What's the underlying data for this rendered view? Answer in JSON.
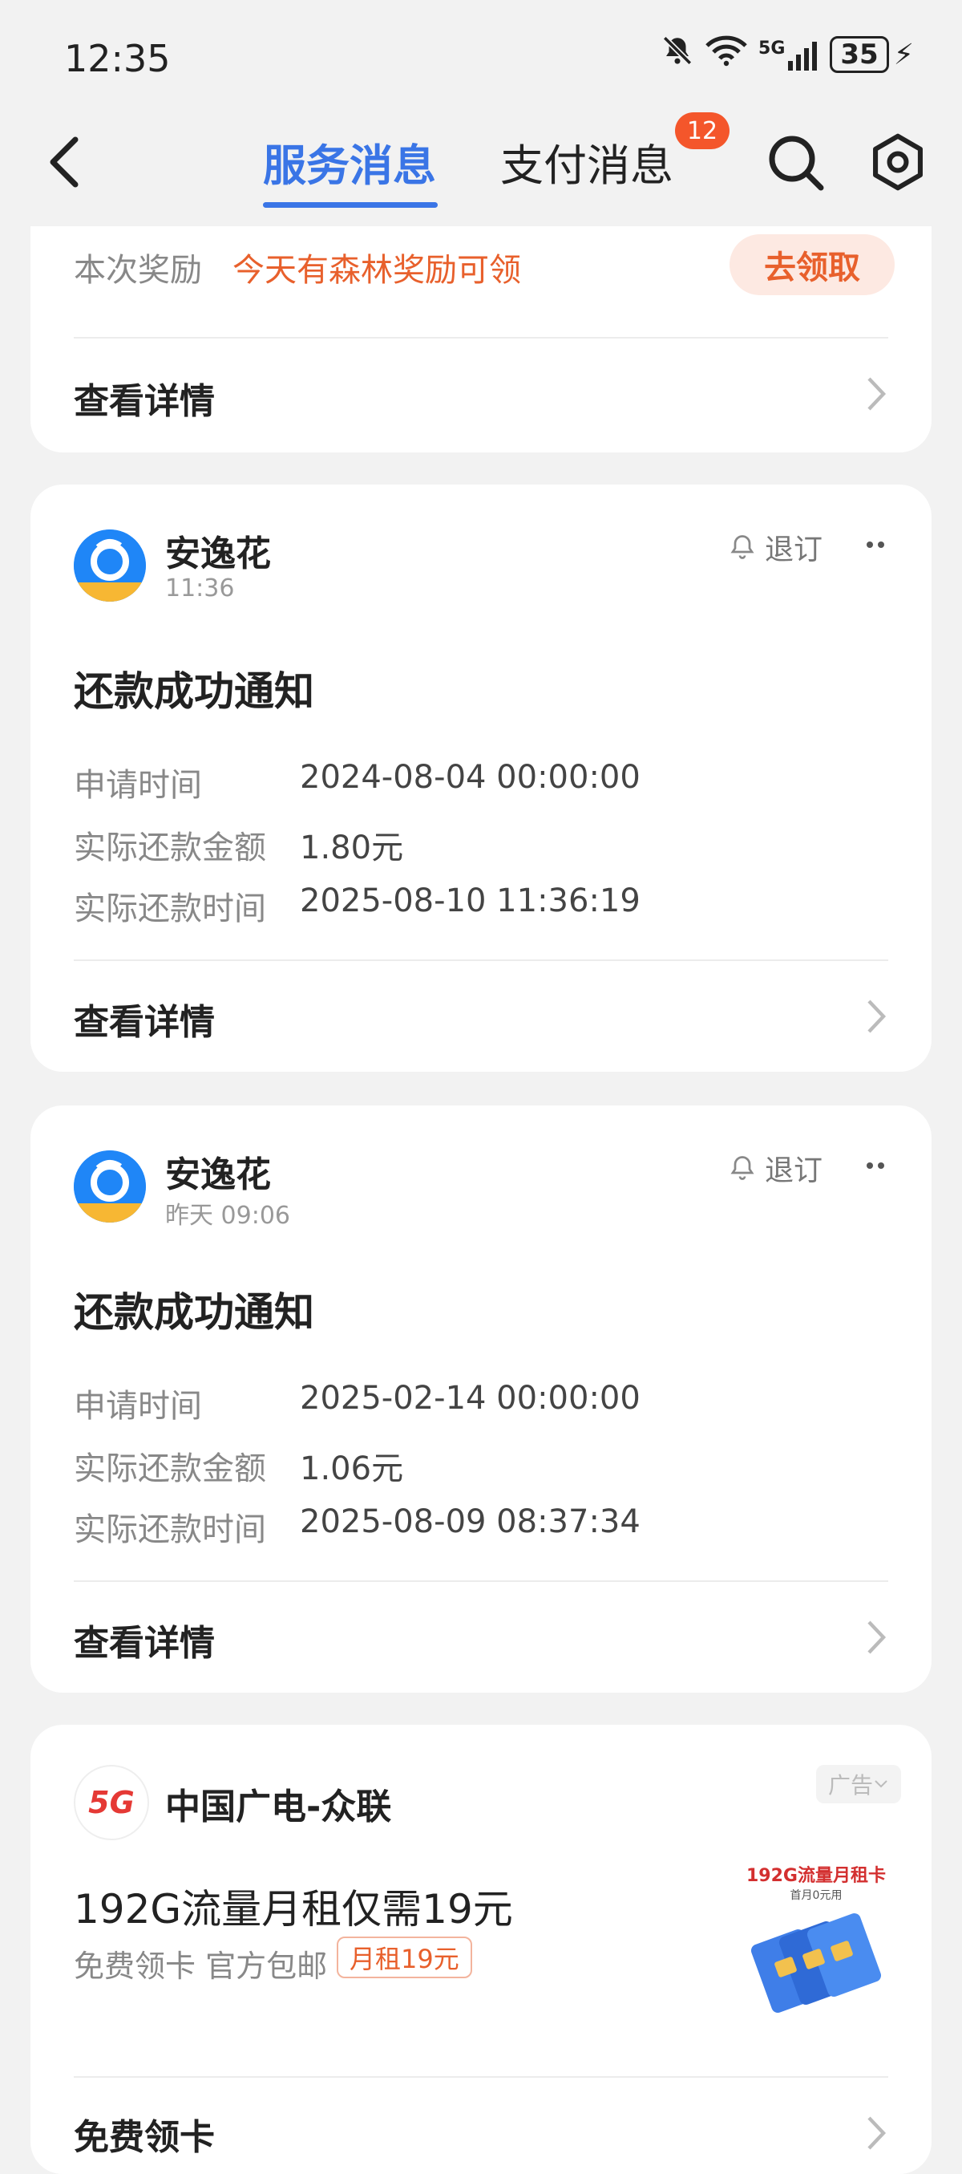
{
  "status_bar": {
    "time": "12:35",
    "battery": "35",
    "network": "5G"
  },
  "header": {
    "tabs": [
      {
        "label": "服务消息",
        "active": true
      },
      {
        "label": "支付消息",
        "active": false,
        "badge": "12"
      }
    ]
  },
  "reward_card": {
    "label": "本次奖励",
    "reward_text": "今天有森林奖励可领",
    "claim_button": "去领取",
    "link": "查看详情"
  },
  "messages": [
    {
      "sender": "安逸花",
      "time": "11:36",
      "unsubscribe": "退订",
      "title": "还款成功通知",
      "fields": [
        {
          "label": "申请时间",
          "value": "2024-08-04 00:00:00"
        },
        {
          "label": "实际还款金额",
          "value": "1.80元"
        },
        {
          "label": "实际还款时间",
          "value": "2025-08-10 11:36:19"
        }
      ],
      "link": "查看详情"
    },
    {
      "sender": "安逸花",
      "time": "昨天 09:06",
      "unsubscribe": "退订",
      "title": "还款成功通知",
      "fields": [
        {
          "label": "申请时间",
          "value": "2025-02-14 00:00:00"
        },
        {
          "label": "实际还款金额",
          "value": "1.06元"
        },
        {
          "label": "实际还款时间",
          "value": "2025-08-09 08:37:34"
        }
      ],
      "link": "查看详情"
    }
  ],
  "ad_card": {
    "sender": "中国广电-众联",
    "logo_text": "5G",
    "ad_badge": "广告",
    "title": "192G流量月租仅需19元",
    "subtitle": "免费领卡 官方包邮",
    "tag": "月租19元",
    "image_title": "192G流量月租卡",
    "image_sub": "首月0元用",
    "link": "免费领卡"
  },
  "colors": {
    "accent": "#3a75e6",
    "orange": "#e8602c",
    "badge": "#f4562b"
  }
}
